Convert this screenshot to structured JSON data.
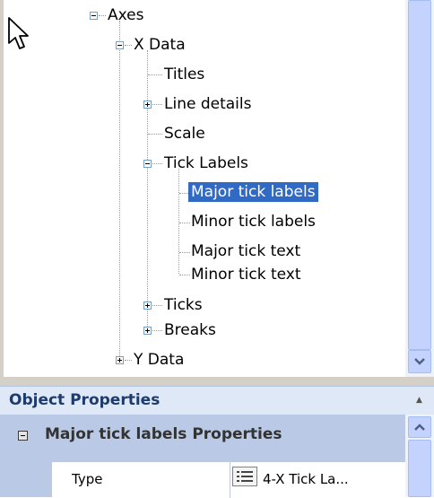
{
  "tree": {
    "nodes": [
      {
        "label": "Axes",
        "expanded": true
      },
      {
        "label": "X Data",
        "expanded": true
      },
      {
        "label": "Titles"
      },
      {
        "label": "Line details",
        "expanded": false
      },
      {
        "label": "Scale"
      },
      {
        "label": "Tick Labels",
        "expanded": true
      },
      {
        "label": "Major tick labels",
        "selected": true
      },
      {
        "label": "Minor tick labels"
      },
      {
        "label": "Major tick text"
      },
      {
        "label": "Minor tick text"
      },
      {
        "label": "Ticks",
        "expanded": false
      },
      {
        "label": "Breaks",
        "expanded": false
      },
      {
        "label": "Y Data",
        "expanded": false
      }
    ]
  },
  "object_properties": {
    "title": "Object Properties",
    "category": "Major tick labels Properties",
    "rows": [
      {
        "name": "Type",
        "value": "4-X Tick La..."
      }
    ]
  },
  "colors": {
    "selection": "#316ac5",
    "header_text": "#1e3b6e",
    "panel_bg": "#b9c9e6"
  },
  "icons": [
    "mouse-pointer-icon",
    "expand-icon",
    "collapse-icon",
    "scroll-down-arrow-icon",
    "scroll-up-arrow-icon",
    "collapse-panel-icon",
    "list-icon"
  ]
}
